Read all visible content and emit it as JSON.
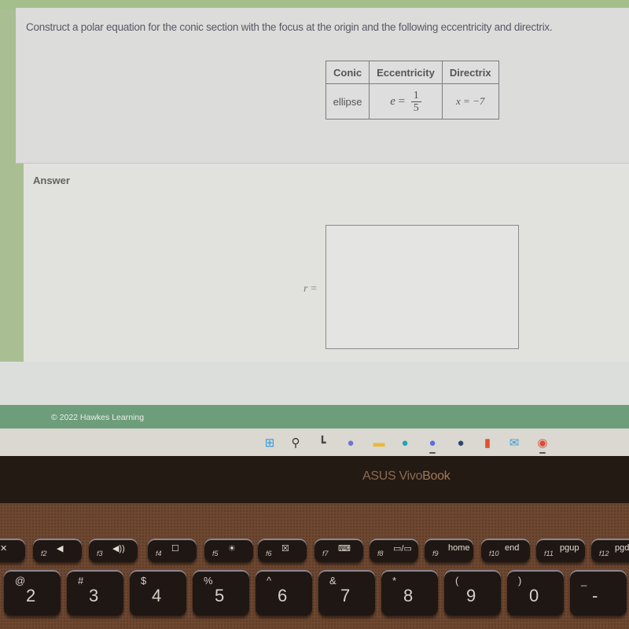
{
  "question": {
    "prompt": "Construct a polar equation for the conic section with the focus at the origin and the following eccentricity and directrix.",
    "table": {
      "headers": [
        "Conic",
        "Eccentricity",
        "Directrix"
      ],
      "row": {
        "conic": "ellipse",
        "eccentricity_var": "e",
        "eccentricity_eq": "=",
        "eccentricity_num": "1",
        "eccentricity_den": "5",
        "directrix": "x = −7"
      }
    }
  },
  "answer": {
    "label": "Answer",
    "r_var": "r",
    "r_eq": "=",
    "value": ""
  },
  "footer": {
    "copyright": "© 2022 Hawkes Learning"
  },
  "taskbar": {
    "icons": [
      {
        "name": "windows-start-icon",
        "glyph": "⊞",
        "color": "#2b9ce0"
      },
      {
        "name": "search-icon",
        "glyph": "⚲",
        "color": "#333333"
      },
      {
        "name": "task-view-icon",
        "glyph": "┗",
        "color": "#444444"
      },
      {
        "name": "teams-chat-icon",
        "glyph": "●",
        "color": "#6b73d6"
      },
      {
        "name": "file-explorer-icon",
        "glyph": "▬",
        "color": "#e9b93a"
      },
      {
        "name": "edge-icon",
        "glyph": "●",
        "color": "#1fa3b9"
      },
      {
        "name": "discord-icon",
        "glyph": "●",
        "color": "#5a6ce0",
        "running": true
      },
      {
        "name": "steam-icon",
        "glyph": "●",
        "color": "#2a4a6a"
      },
      {
        "name": "office-icon",
        "glyph": "▮",
        "color": "#e2502e"
      },
      {
        "name": "mail-icon",
        "glyph": "✉",
        "color": "#3aa0d8"
      },
      {
        "name": "chrome-icon",
        "glyph": "◉",
        "color": "#dd4b39",
        "running": true
      }
    ]
  },
  "laptop": {
    "brand_prefix": "ASUS ",
    "brand_vivo": "Vivo",
    "brand_book": "Book"
  },
  "keyboard": {
    "fkeys": [
      {
        "fn": "",
        "glyph": "✕"
      },
      {
        "fn": "f2",
        "glyph": "◀"
      },
      {
        "fn": "f3",
        "glyph": "◀))"
      },
      {
        "fn": "f4",
        "glyph": "☐"
      },
      {
        "fn": "f5",
        "glyph": "☀"
      },
      {
        "fn": "f6",
        "glyph": "☒"
      },
      {
        "fn": "f7",
        "glyph": "⌨"
      },
      {
        "fn": "f8",
        "glyph": "▭/▭"
      },
      {
        "fn": "f9",
        "glyph": "home"
      },
      {
        "fn": "f10",
        "glyph": "end"
      },
      {
        "fn": "f11",
        "glyph": "pgup"
      },
      {
        "fn": "f12",
        "glyph": "pgdn"
      }
    ],
    "numkeys": [
      {
        "sym": "@",
        "num": "2"
      },
      {
        "sym": "#",
        "num": "3"
      },
      {
        "sym": "$",
        "num": "4"
      },
      {
        "sym": "%",
        "num": "5"
      },
      {
        "sym": "^",
        "num": "6"
      },
      {
        "sym": "&",
        "num": "7"
      },
      {
        "sym": "*",
        "num": "8"
      },
      {
        "sym": "(",
        "num": "9"
      },
      {
        "sym": ")",
        "num": "0"
      },
      {
        "sym": "_",
        "num": "-"
      }
    ]
  }
}
